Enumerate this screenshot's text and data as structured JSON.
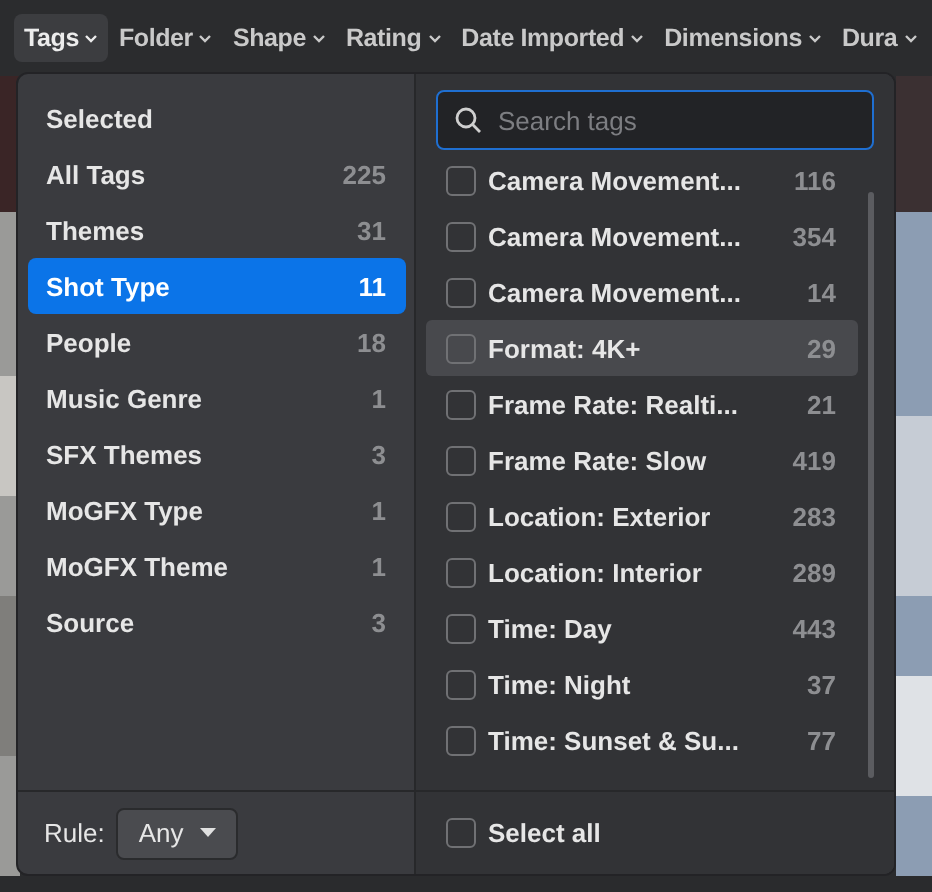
{
  "filter_bar": [
    {
      "label": "Tags",
      "selected": true
    },
    {
      "label": "Folder",
      "selected": false
    },
    {
      "label": "Shape",
      "selected": false
    },
    {
      "label": "Rating",
      "selected": false
    },
    {
      "label": "Date Imported",
      "selected": false
    },
    {
      "label": "Dimensions",
      "selected": false
    },
    {
      "label": "Dura",
      "selected": false
    }
  ],
  "tag_groups": [
    {
      "label": "Selected",
      "selected": false
    },
    {
      "label": "All Tags",
      "count": "225",
      "selected": false
    },
    {
      "label": "Themes",
      "count": "31",
      "selected": false
    },
    {
      "label": "Shot Type",
      "count": "11",
      "selected": true
    },
    {
      "label": "People",
      "count": "18",
      "selected": false
    },
    {
      "label": "Music Genre",
      "count": "1",
      "selected": false
    },
    {
      "label": "SFX Themes",
      "count": "3",
      "selected": false
    },
    {
      "label": "MoGFX Type",
      "count": "1",
      "selected": false
    },
    {
      "label": "MoGFX Theme",
      "count": "1",
      "selected": false
    },
    {
      "label": "Source",
      "count": "3",
      "selected": false
    }
  ],
  "search": {
    "placeholder": "Search tags"
  },
  "tags": [
    {
      "label": "Camera Movement...",
      "count": "116",
      "checked": false,
      "highlighted": false
    },
    {
      "label": "Camera Movement...",
      "count": "354",
      "checked": false,
      "highlighted": false
    },
    {
      "label": "Camera Movement...",
      "count": "14",
      "checked": false,
      "highlighted": false
    },
    {
      "label": "Format: 4K+",
      "count": "29",
      "checked": false,
      "highlighted": true
    },
    {
      "label": "Frame Rate: Realti...",
      "count": "21",
      "checked": false,
      "highlighted": false
    },
    {
      "label": "Frame Rate: Slow",
      "count": "419",
      "checked": false,
      "highlighted": false
    },
    {
      "label": "Location: Exterior",
      "count": "283",
      "checked": false,
      "highlighted": false
    },
    {
      "label": "Location: Interior",
      "count": "289",
      "checked": false,
      "highlighted": false
    },
    {
      "label": "Time: Day",
      "count": "443",
      "checked": false,
      "highlighted": false
    },
    {
      "label": "Time: Night",
      "count": "37",
      "checked": false,
      "highlighted": false
    },
    {
      "label": "Time: Sunset & Su...",
      "count": "77",
      "checked": false,
      "highlighted": false
    }
  ],
  "rule": {
    "label": "Rule:",
    "value": "Any"
  },
  "select_all": {
    "label": "Select all",
    "checked": false
  }
}
